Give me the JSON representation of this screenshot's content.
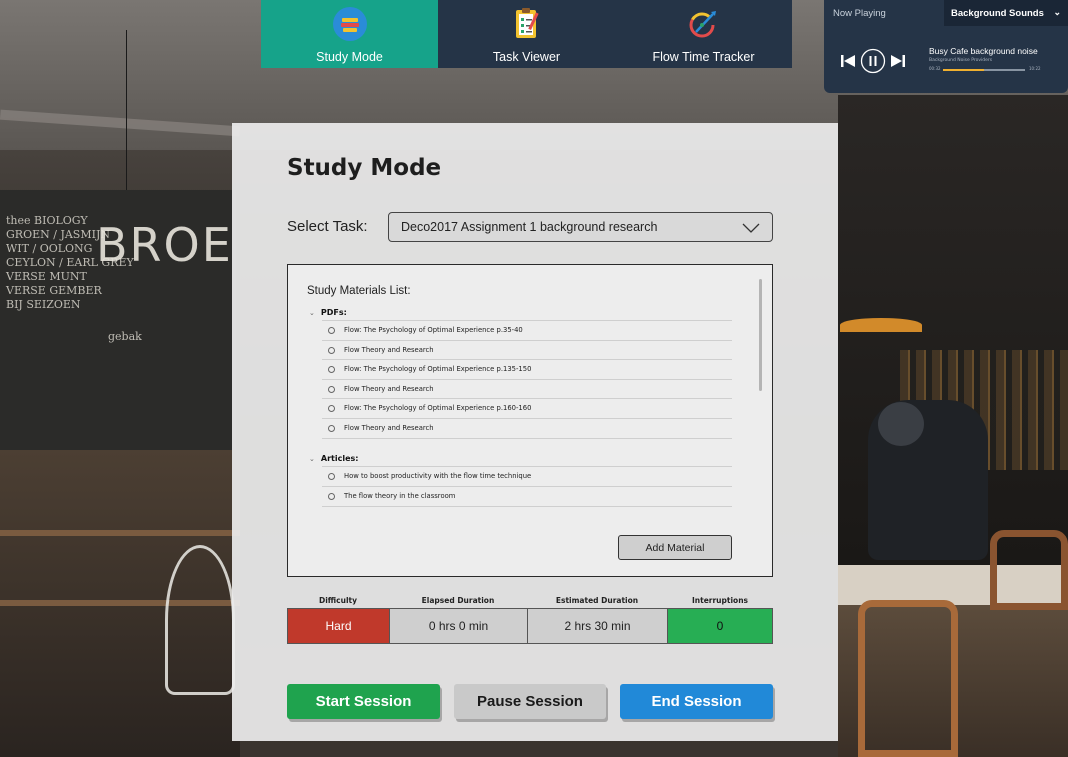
{
  "nav": {
    "tabs": [
      {
        "label": "Study Mode",
        "icon": "study-icon",
        "active": true
      },
      {
        "label": "Task Viewer",
        "icon": "clipboard-icon",
        "active": false
      },
      {
        "label": "Flow Time Tracker",
        "icon": "tracker-icon",
        "active": false
      }
    ]
  },
  "player": {
    "now_playing": "Now Playing",
    "source": "Background Sounds",
    "track_title": "Busy Cafe background noise",
    "track_subtitle": "Background Noise Providers",
    "elapsed": "00:32",
    "total": "10:22",
    "progress": 0.5
  },
  "study": {
    "title": "Study Mode",
    "select_label": "Select Task:",
    "selected_task": "Deco2017 Assignment 1 background research",
    "materials_title": "Study Materials List:",
    "groups": [
      {
        "name": "PDFs:",
        "items": [
          "Flow: The Psychology of Optimal Experience p.35-40",
          "Flow Theory and Research",
          "Flow: The Psychology of Optimal Experience p.135-150",
          "Flow Theory and Research",
          "Flow: The Psychology of Optimal Experience p.160-160",
          "Flow Theory and Research"
        ]
      },
      {
        "name": "Articles:",
        "items": [
          "How to boost productivity with the flow time technique",
          "The flow theory in the classroom"
        ]
      }
    ],
    "add_material": "Add Material",
    "stats": {
      "labels": [
        "Difficulty",
        "Elapsed Duration",
        "Estimated Duration",
        "Interruptions"
      ],
      "values": [
        "Hard",
        "0 hrs 0 min",
        "2 hrs 30 min",
        "0"
      ]
    },
    "buttons": {
      "start": "Start Session",
      "pause": "Pause Session",
      "end": "End Session"
    }
  },
  "colors": {
    "nav_bg": "#253447",
    "nav_active": "#16a38a",
    "difficulty_hard": "#c0392b",
    "interruptions_ok": "#27ae54",
    "start": "#1fa34e",
    "end": "#2189d8"
  }
}
